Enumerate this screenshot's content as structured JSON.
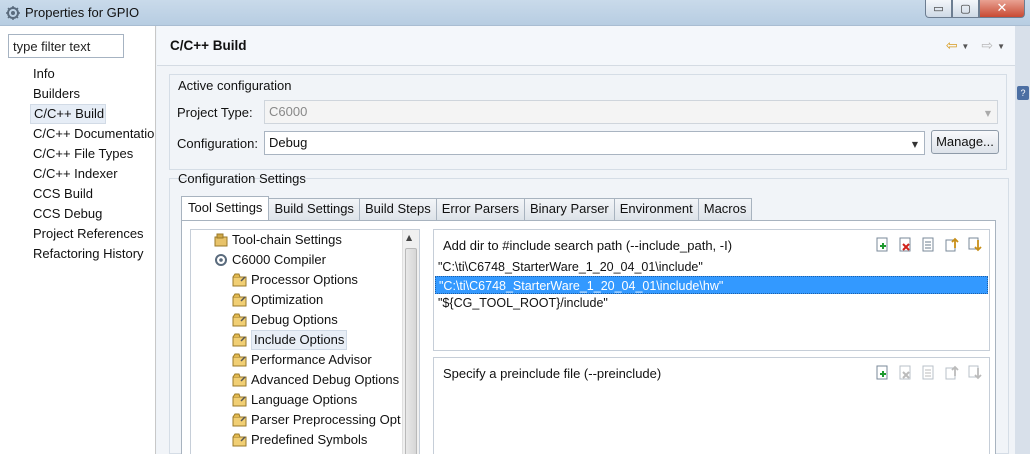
{
  "window": {
    "title": "Properties for GPIO",
    "controls": {
      "minimize": "▭",
      "maximize": "▢",
      "close": "✕"
    }
  },
  "sidebar": {
    "filter_placeholder": "type filter text",
    "items": [
      {
        "label": "Info"
      },
      {
        "label": "Builders"
      },
      {
        "label": "C/C++ Build",
        "selected": true
      },
      {
        "label": "C/C++ Documentatio"
      },
      {
        "label": "C/C++ File Types"
      },
      {
        "label": "C/C++ Indexer"
      },
      {
        "label": "CCS Build"
      },
      {
        "label": "CCS Debug"
      },
      {
        "label": "Project References"
      },
      {
        "label": "Refactoring History"
      }
    ]
  },
  "header": {
    "title": "C/C++ Build",
    "back_icon": "⇦",
    "forward_icon": "⇨",
    "dropdown_icon": "▼"
  },
  "active_configuration": {
    "group_label": "Active configuration",
    "project_type_label": "Project Type:",
    "project_type_value": "C6000",
    "configuration_label": "Configuration:",
    "configuration_value": "Debug",
    "manage_button": "Manage..."
  },
  "configuration_settings": {
    "group_label": "Configuration Settings",
    "tabs": [
      {
        "label": "Tool Settings",
        "active": true
      },
      {
        "label": "Build Settings"
      },
      {
        "label": "Build Steps"
      },
      {
        "label": "Error Parsers"
      },
      {
        "label": "Binary Parser"
      },
      {
        "label": "Environment"
      },
      {
        "label": "Macros"
      }
    ],
    "tree": [
      {
        "label": "Tool-chain Settings",
        "level": 0,
        "icon": "settings-icon"
      },
      {
        "label": "C6000 Compiler",
        "level": 0,
        "icon": "compiler-icon"
      },
      {
        "label": "Processor Options",
        "level": 1,
        "icon": "options-folder-icon"
      },
      {
        "label": "Optimization",
        "level": 1,
        "icon": "options-folder-icon"
      },
      {
        "label": "Debug Options",
        "level": 1,
        "icon": "options-folder-icon"
      },
      {
        "label": "Include Options",
        "level": 1,
        "icon": "options-folder-icon",
        "selected": true
      },
      {
        "label": "Performance Advisor",
        "level": 1,
        "icon": "options-folder-icon"
      },
      {
        "label": "Advanced Debug Options",
        "level": 1,
        "icon": "options-folder-icon"
      },
      {
        "label": "Language Options",
        "level": 1,
        "icon": "options-folder-icon"
      },
      {
        "label": "Parser Preprocessing Opt",
        "level": 1,
        "icon": "options-folder-icon"
      },
      {
        "label": "Predefined Symbols",
        "level": 1,
        "icon": "options-folder-icon"
      }
    ],
    "include_paths": {
      "title": "Add dir to #include search path (--include_path, -I)",
      "items": [
        {
          "value": "\"C:\\ti\\C6748_StarterWare_1_20_04_01\\include\""
        },
        {
          "value": "\"C:\\ti\\C6748_StarterWare_1_20_04_01\\include\\hw\"",
          "selected": true
        },
        {
          "value": "\"${CG_TOOL_ROOT}/include\""
        }
      ]
    },
    "preinclude": {
      "title": "Specify a preinclude file (--preinclude)",
      "items": []
    },
    "list_tools": [
      "add-icon",
      "delete-icon",
      "edit-icon",
      "move-up-icon",
      "move-down-icon"
    ]
  },
  "colors": {
    "selection": "#3399ff",
    "titlebar": "#c9daea",
    "accent_arrow": "#d79b1f"
  }
}
